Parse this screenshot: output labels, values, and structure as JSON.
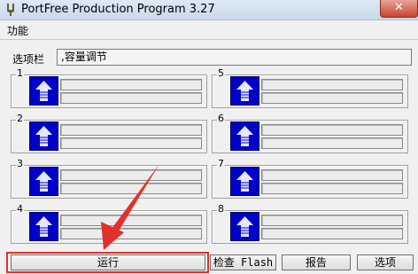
{
  "window": {
    "title": "PortFree Production Program 3.27",
    "close_glyph": "✕"
  },
  "menu": {
    "function_label": "功能"
  },
  "options": {
    "label": "选项栏",
    "value": ",容量调节"
  },
  "slots": [
    {
      "number": "1"
    },
    {
      "number": "2"
    },
    {
      "number": "3"
    },
    {
      "number": "4"
    },
    {
      "number": "5"
    },
    {
      "number": "6"
    },
    {
      "number": "7"
    },
    {
      "number": "8"
    }
  ],
  "buttons": {
    "run": "运行",
    "check_flash": "检查 Flash",
    "report": "报告",
    "options": "选项"
  },
  "icons": {
    "slot_icon": "up-arrow-icon",
    "app_icon": "tuning-fork-icon"
  },
  "colors": {
    "slot_icon_bg": "#0000c8",
    "annotation": "#e0322a"
  }
}
